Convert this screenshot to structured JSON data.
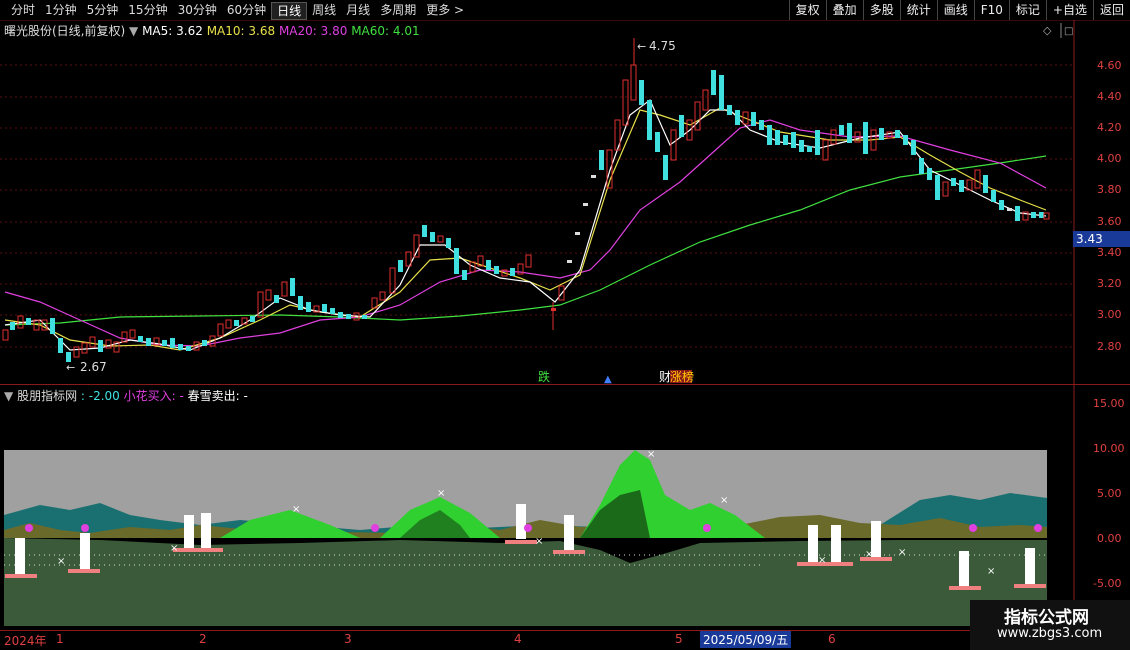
{
  "toolbar": {
    "tabs": [
      "分时",
      "1分钟",
      "5分钟",
      "15分钟",
      "30分钟",
      "60分钟",
      "日线",
      "周线",
      "月线",
      "多周期",
      "更多 >"
    ],
    "active_tab": "日线",
    "right_buttons": [
      "复权",
      "叠加",
      "多股",
      "统计",
      "画线",
      "F10",
      "标记",
      "+自选",
      "返回"
    ]
  },
  "main_panel": {
    "title": "曙光股份(日线,前复权)",
    "ma5": "MA5: 3.62",
    "ma10": "MA10: 3.68",
    "ma20": "MA20: 3.80",
    "ma60": "MA60: 4.01",
    "high_label": "4.75",
    "low_label": "2.67",
    "current_price": "3.43",
    "y_ticks": [
      "4.60",
      "4.40",
      "4.20",
      "4.00",
      "3.80",
      "3.60",
      "3.40",
      "3.20",
      "3.00",
      "2.80"
    ],
    "markers": [
      "跌",
      "财",
      "涨榜"
    ]
  },
  "sub_panel": {
    "title": "股朋指标网",
    "value": ": -2.00",
    "buy_label": "小花买入: -",
    "sell_label": "春雪卖出: -",
    "y_ticks": [
      "15.00",
      "10.00",
      "5.00",
      "0.00",
      "-5.00"
    ]
  },
  "dates": {
    "year": "2024年",
    "months": [
      "1",
      "2",
      "3",
      "4",
      "5",
      "6"
    ],
    "highlight": "2025/05/09/五"
  },
  "watermark": {
    "title": "指标公式网",
    "url": "www.zbgs3.com"
  },
  "colors": {
    "ma5": "#ffffff",
    "ma10": "#e8e04a",
    "ma20": "#e040e0",
    "ma60": "#40e040",
    "up": "#e03030",
    "down": "#40e0e0"
  }
}
